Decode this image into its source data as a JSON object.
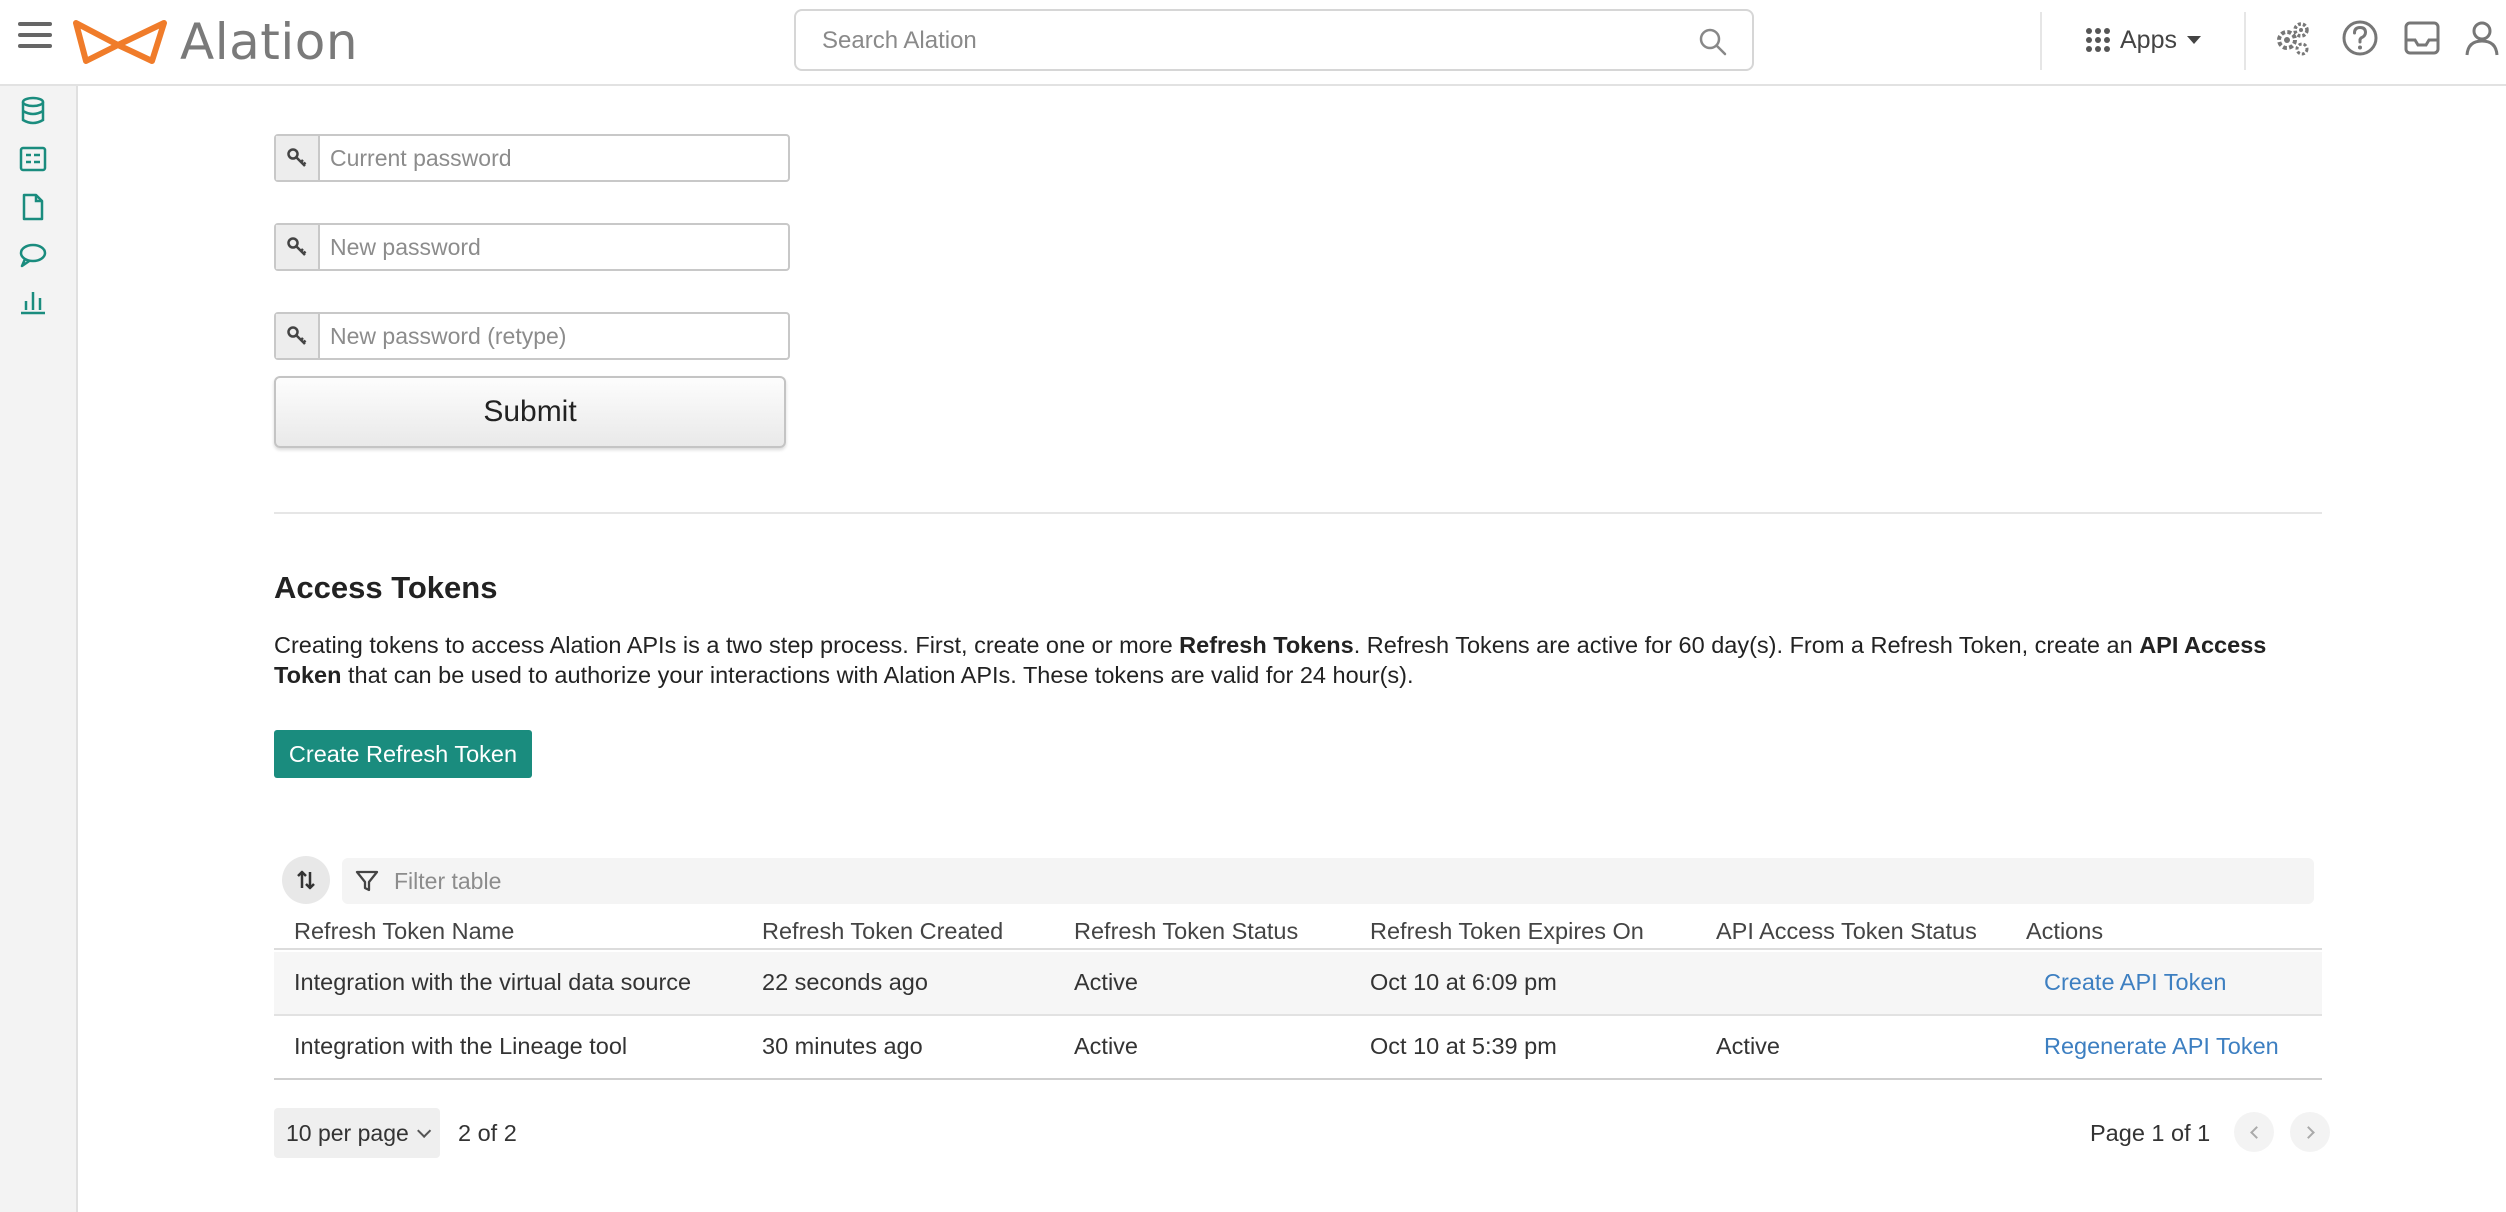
{
  "header": {
    "logo_text": "Alation",
    "search_placeholder": "Search Alation",
    "apps_label": "Apps"
  },
  "password_form": {
    "current_placeholder": "Current password",
    "new_placeholder": "New password",
    "retype_placeholder": "New password (retype)",
    "submit_label": "Submit"
  },
  "access_tokens": {
    "title": "Access Tokens",
    "desc_part1": "Creating tokens to access Alation APIs is a two step process. First, create one or more ",
    "desc_bold1": "Refresh Tokens",
    "desc_part2": ". Refresh Tokens are active for 60 day(s). From a Refresh Token, create an ",
    "desc_bold2": "API Access Token",
    "desc_part3": " that can be used to authorize your interactions with Alation APIs. These tokens are valid for 24 hour(s).",
    "create_button": "Create Refresh Token"
  },
  "table": {
    "filter_placeholder": "Filter table",
    "columns": [
      "Refresh Token Name",
      "Refresh Token Created",
      "Refresh Token Status",
      "Refresh Token Expires On",
      "API Access Token Status",
      "Actions"
    ],
    "rows": [
      {
        "name": "Integration with the virtual data source",
        "created": "22 seconds ago",
        "status": "Active",
        "expires": "Oct 10 at 6:09 pm",
        "api_status": "",
        "action": "Create API Token"
      },
      {
        "name": "Integration with the Lineage tool",
        "created": "30 minutes ago",
        "status": "Active",
        "expires": "Oct 10 at 5:39 pm",
        "api_status": "Active",
        "action": "Regenerate API Token"
      }
    ]
  },
  "pagination": {
    "per_page": "10 per page",
    "count": "2 of 2",
    "page_info": "Page 1 of 1"
  },
  "colors": {
    "brand_orange": "#f07c2a",
    "accent_teal": "#1a8c7e",
    "link_blue": "#3d7fc1"
  }
}
